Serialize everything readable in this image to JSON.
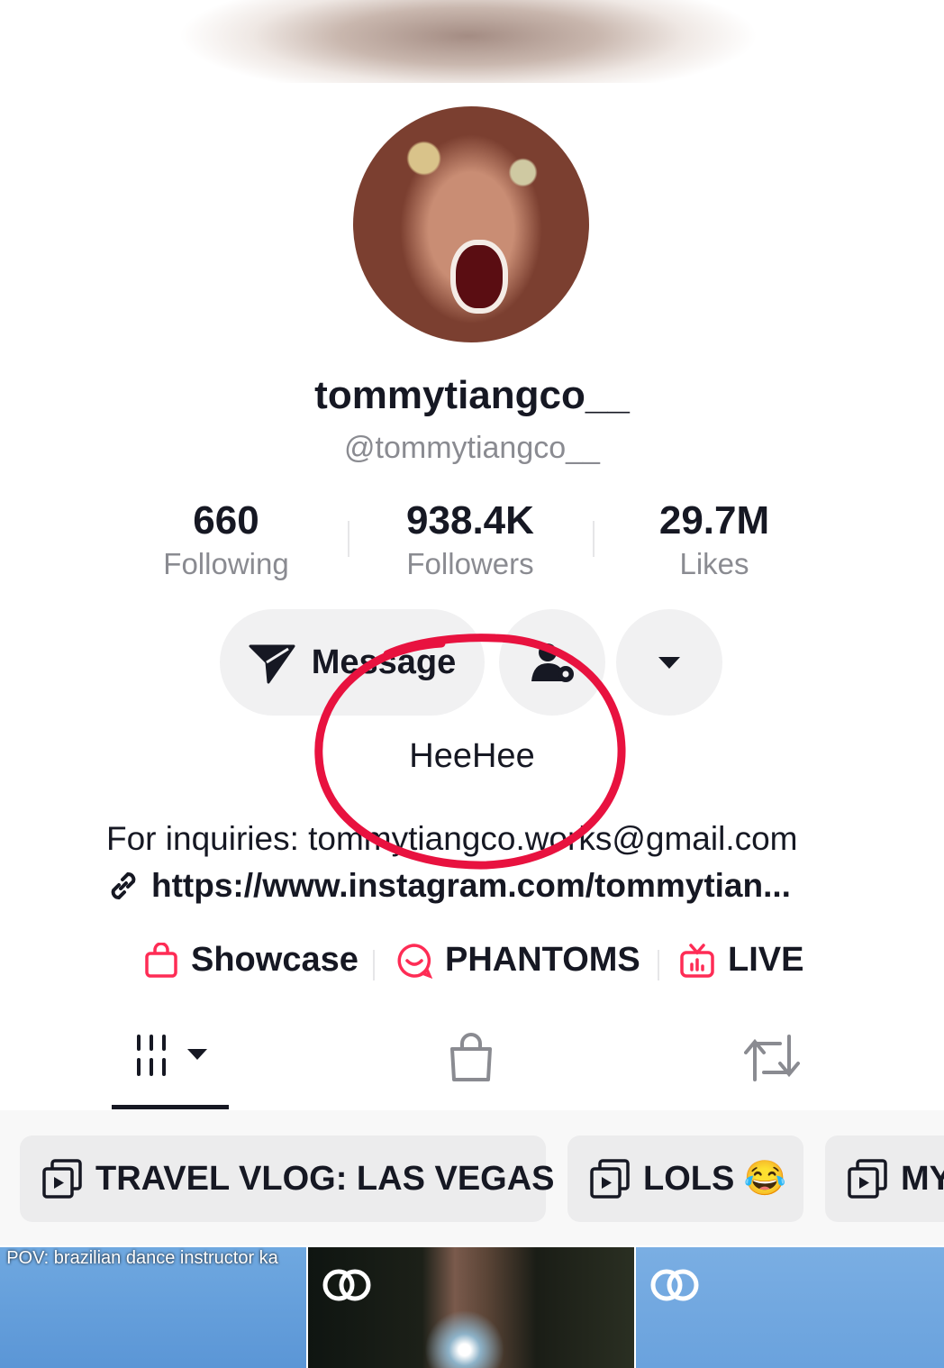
{
  "profile": {
    "display_name": "tommytiangco__",
    "handle": "@tommytiangco__"
  },
  "stats": [
    {
      "value": "660",
      "label": "Following"
    },
    {
      "value": "938.4K",
      "label": "Followers"
    },
    {
      "value": "29.7M",
      "label": "Likes"
    }
  ],
  "actions": {
    "message_label": "Message",
    "follow_icon": "person-gear-icon",
    "more_icon": "caret-down-icon"
  },
  "bio": {
    "main": "HeeHee",
    "inquiries": "For inquiries: tommytiangco.works@gmail.com",
    "link": "https://www.instagram.com/tommytian..."
  },
  "badges": [
    {
      "label": "Showcase",
      "icon": "bag-icon"
    },
    {
      "label": "PHANTOMS",
      "icon": "chat-face-icon"
    },
    {
      "label": "LIVE",
      "icon": "tv-icon"
    }
  ],
  "tabs": [
    {
      "icon": "videos-grid-icon",
      "active": true
    },
    {
      "icon": "shop-bag-icon",
      "active": false
    },
    {
      "icon": "repost-icon",
      "active": false
    }
  ],
  "playlists": [
    {
      "label": "TRAVEL VLOG: LAS VEGAS",
      "icon": "playlist-icon"
    },
    {
      "label": "LOLS 😂",
      "icon": "playlist-icon"
    },
    {
      "label": "MY",
      "icon": "playlist-icon"
    }
  ],
  "videos": [
    {
      "caption": "POV: brazilian dance instructor ka",
      "badge_icon": ""
    },
    {
      "caption": "",
      "badge_icon": "collab-icon"
    },
    {
      "caption": "",
      "badge_icon": "collab-icon"
    }
  ],
  "colors": {
    "accent": "#fe2c55",
    "annotation": "#e8123f",
    "muted_text": "#8a8b91",
    "button_bg": "#f1f1f2"
  }
}
